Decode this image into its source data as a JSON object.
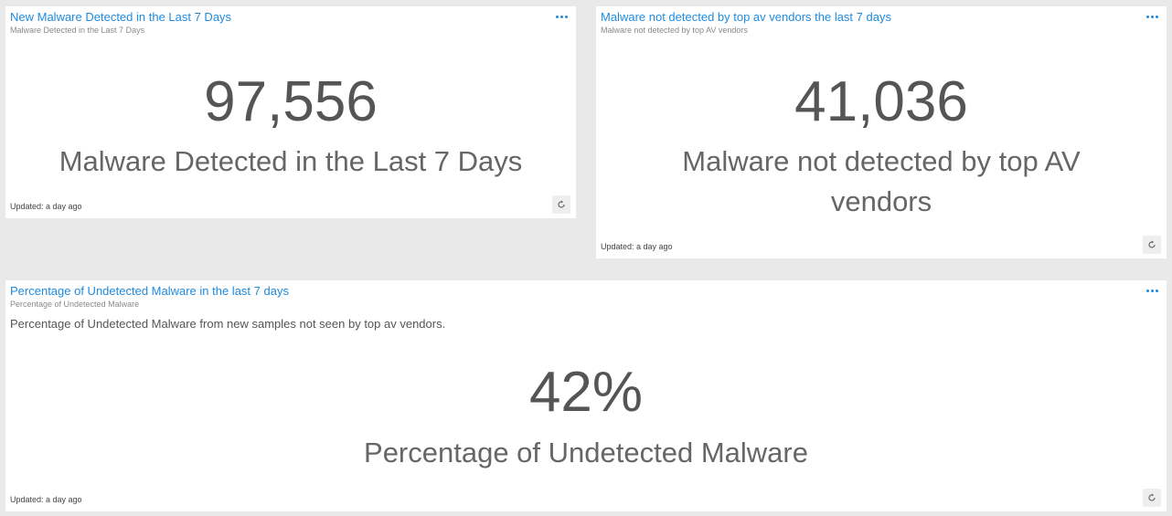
{
  "panels": [
    {
      "title": "New Malware Detected in the Last 7 Days",
      "subtitle": "Malware Detected in the Last 7 Days",
      "value": "97,556",
      "label": "Malware Detected in the Last 7 Days",
      "updated": "Updated: a day ago"
    },
    {
      "title": "Malware not detected by top av vendors the last 7 days",
      "subtitle": "Malware not detected by top AV vendors",
      "value": "41,036",
      "label": "Malware not detected by top AV vendors",
      "updated": "Updated: a day ago"
    },
    {
      "title": "Percentage of Undetected Malware in the last 7 days",
      "subtitle": "Percentage of Undetected Malware",
      "description": "Percentage of Undetected Malware from new samples not seen by top av vendors.",
      "value": "42%",
      "label": "Percentage of Undetected Malware",
      "updated": "Updated: a day ago"
    }
  ],
  "icons": {
    "menu": "more-options-icon",
    "refresh": "refresh-icon"
  },
  "colors": {
    "title_link": "#1e8be0",
    "metric_text": "#555555",
    "background": "#e9e9e9"
  }
}
